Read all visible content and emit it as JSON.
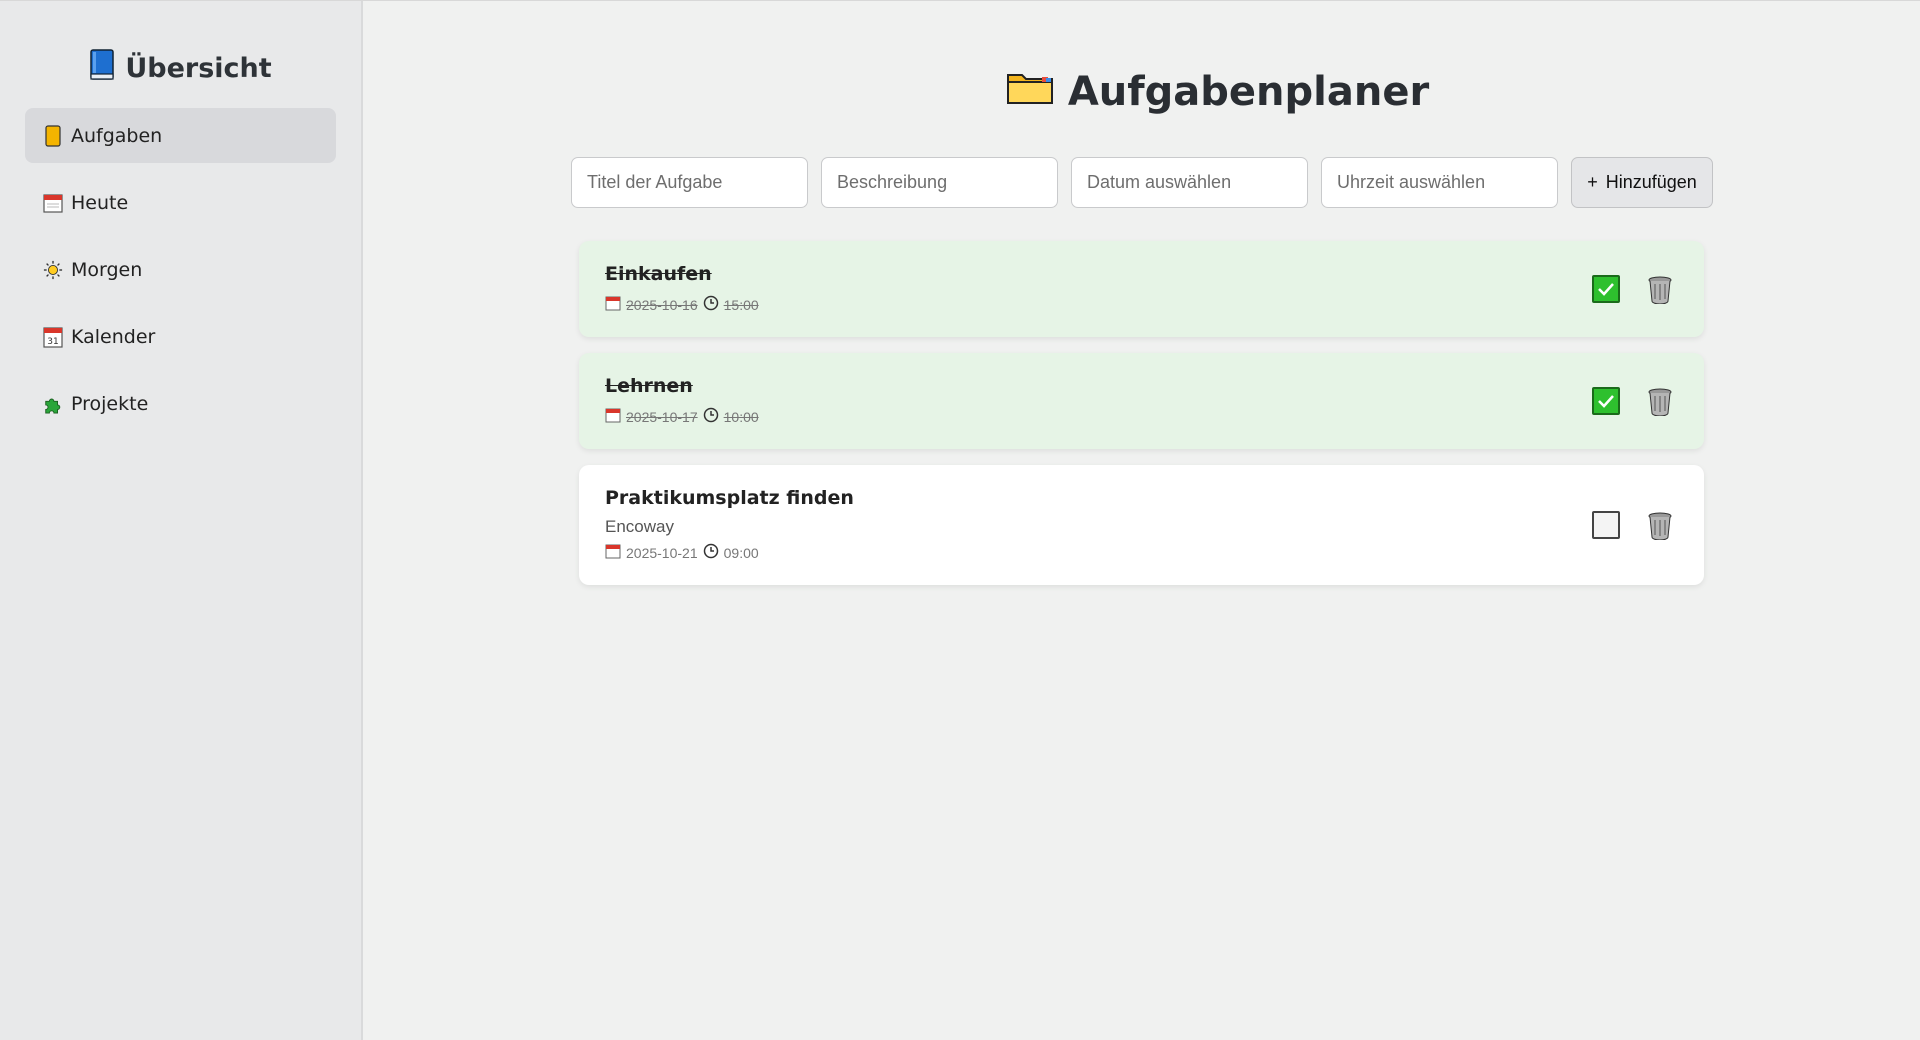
{
  "sidebar": {
    "title": "Übersicht",
    "title_icon": "blue-book-icon",
    "items": [
      {
        "label": "Aufgaben",
        "icon": "clipboard-icon",
        "active": true
      },
      {
        "label": "Heute",
        "icon": "calendar-today-icon",
        "active": false
      },
      {
        "label": "Morgen",
        "icon": "sun-icon",
        "active": false
      },
      {
        "label": "Kalender",
        "icon": "calendar-31-icon",
        "active": false
      },
      {
        "label": "Projekte",
        "icon": "puzzle-icon",
        "active": false
      }
    ]
  },
  "main": {
    "title": "Aufgabenplaner",
    "title_icon": "folder-icon",
    "form": {
      "title_placeholder": "Titel der Aufgabe",
      "desc_placeholder": "Beschreibung",
      "date_placeholder": "Datum auswählen",
      "time_placeholder": "Uhrzeit auswählen",
      "add_label": "Hinzufügen",
      "add_symbol": "+"
    },
    "tasks": [
      {
        "title": "Einkaufen",
        "description": "",
        "date": "2025-10-16",
        "time": "15:00",
        "done": true
      },
      {
        "title": "Lehrnen",
        "description": "",
        "date": "2025-10-17",
        "time": "10:00",
        "done": true
      },
      {
        "title": "Praktikumsplatz finden",
        "description": "Encoway",
        "date": "2025-10-21",
        "time": "09:00",
        "done": false
      }
    ]
  },
  "colors": {
    "done_bg": "#e6f4e6",
    "check_green": "#2ec02e",
    "sidebar_bg": "#e8e9ea",
    "page_bg": "#f0f1f0"
  }
}
